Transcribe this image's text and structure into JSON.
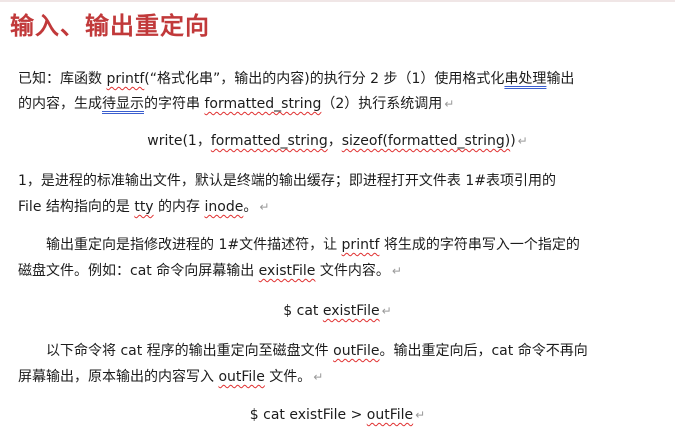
{
  "title": "输入、输出重定向",
  "mark": "↵",
  "p1": {
    "a": "已知：库函数 ",
    "printf": "printf",
    "b": "(“格式化串”，输出的内容)的执行分 2 步（1）使用格式化",
    "chuan": "串处理",
    "c": "输出",
    "d": "的内容，生成",
    "daixianshi": "待显示",
    "e": "的字符串 ",
    "fs": "formatted_string",
    "f": "（2）执行系统调用"
  },
  "p2": {
    "a": "write(1，",
    "fs": "formatted_string",
    "b": "，",
    "sizeof": "sizeof(formatted_string)",
    "c": ")"
  },
  "p3": {
    "a": "1，是进程的标准输出文件，默认是终端的输出缓存；即进程打开文件表 1#表项引用的",
    "b": "File 结构指向的是 ",
    "tty": "tty",
    "c": " 的内存 ",
    "inode": "inode",
    "d": "。"
  },
  "p4": {
    "a": "输出重定向是指修改进程的 1#文件描述符，让 ",
    "printf": "printf",
    "b": " 将生成的字符串写入一个指定的",
    "c": "磁盘文件。例如：cat 命令向屏幕输出 ",
    "existFile": "existFile",
    "d": " 文件内容。"
  },
  "p5": {
    "a": "$ cat ",
    "existFile": "existFile"
  },
  "p6": {
    "a": "以下命令将 cat 程序的输出重定向至磁盘文件 ",
    "outFile": "outFile",
    "b": "。输出重定向后，cat 命令不再向",
    "c": "屏幕输出，原本输出的内容写入 ",
    "outFile2": "outFile",
    "d": " 文件。"
  },
  "p7": {
    "a": "$ cat existFile > ",
    "outFile": "outFile"
  }
}
